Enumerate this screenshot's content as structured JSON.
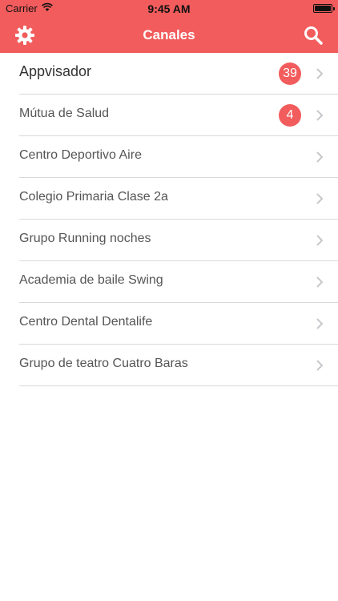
{
  "status_bar": {
    "carrier": "Carrier",
    "time": "9:45 AM"
  },
  "header": {
    "title": "Canales",
    "left_icon": "gear-icon",
    "right_icon": "search-icon"
  },
  "channels": [
    {
      "label": "Appvisador",
      "badge": "39"
    },
    {
      "label": "Mútua de Salud",
      "badge": "4"
    },
    {
      "label": "Centro Deportivo Aire",
      "badge": ""
    },
    {
      "label": "Colegio Primaria Clase 2a",
      "badge": ""
    },
    {
      "label": "Grupo Running noches",
      "badge": ""
    },
    {
      "label": "Academia de baile Swing",
      "badge": ""
    },
    {
      "label": "Centro Dental Dentalife",
      "badge": ""
    },
    {
      "label": "Grupo de teatro Cuatro Baras",
      "badge": ""
    }
  ],
  "colors": {
    "accent": "#f25c5c",
    "separator": "#d9d9d9",
    "chevron": "#c7c7cc"
  }
}
